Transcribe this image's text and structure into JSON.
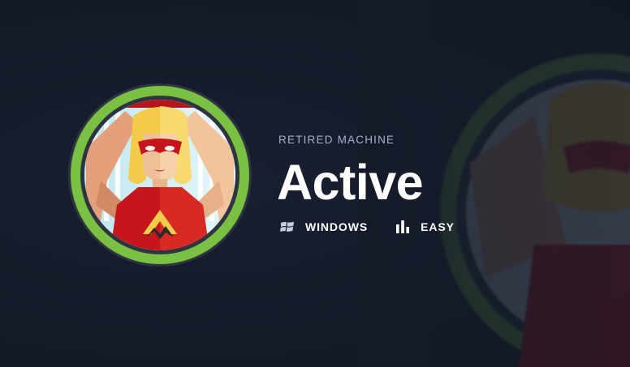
{
  "machine": {
    "status": "RETIRED MACHINE",
    "name": "Active",
    "os": {
      "label": "WINDOWS",
      "icon": "windows-icon"
    },
    "difficulty": {
      "label": "EASY",
      "icon": "difficulty-bars-icon"
    }
  },
  "avatar": {
    "icon": "machine-avatar-icon",
    "ring_color": "#7ac043",
    "accent_color": "#c4161c"
  },
  "colors": {
    "background": "#141a28",
    "muted_text": "#a4b1cd",
    "text": "#ffffff"
  }
}
